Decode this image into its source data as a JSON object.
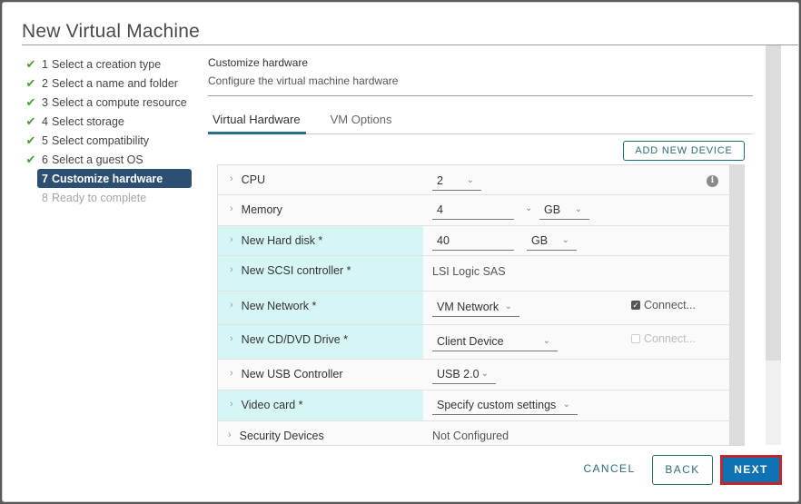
{
  "dialog": {
    "title": "New Virtual Machine"
  },
  "steps": [
    {
      "number": "1",
      "label": "Select a creation type",
      "state": "done"
    },
    {
      "number": "2",
      "label": "Select a name and folder",
      "state": "done"
    },
    {
      "number": "3",
      "label": "Select a compute resource",
      "state": "done"
    },
    {
      "number": "4",
      "label": "Select storage",
      "state": "done"
    },
    {
      "number": "5",
      "label": "Select compatibility",
      "state": "done"
    },
    {
      "number": "6",
      "label": "Select a guest OS",
      "state": "done"
    },
    {
      "number": "7",
      "label": "Customize hardware",
      "state": "active"
    },
    {
      "number": "8",
      "label": "Ready to complete",
      "state": "disabled"
    }
  ],
  "icons": {
    "check": "✔",
    "chevron": "›",
    "dropdown": "⌄",
    "info": "i"
  },
  "content": {
    "title": "Customize hardware",
    "subtitle": "Configure the virtual machine hardware"
  },
  "tabs": [
    {
      "label": "Virtual Hardware",
      "active": true
    },
    {
      "label": "VM Options",
      "active": false
    }
  ],
  "add_device_label": "ADD NEW DEVICE",
  "hardware": {
    "cpu": {
      "label": "CPU",
      "value": "2"
    },
    "memory": {
      "label": "Memory",
      "value": "4",
      "unit": "GB"
    },
    "hard_disk": {
      "label": "New Hard disk *",
      "value": "40",
      "unit": "GB"
    },
    "scsi": {
      "label": "New SCSI controller *",
      "value": "LSI Logic SAS"
    },
    "network": {
      "label": "New Network *",
      "value": "VM Network",
      "connect_label": "Connect...",
      "connect_checked": true
    },
    "cdrom": {
      "label": "New CD/DVD Drive *",
      "value": "Client Device",
      "connect_label": "Connect...",
      "connect_checked": false
    },
    "usb": {
      "label": "New USB Controller",
      "value": "USB 2.0"
    },
    "video": {
      "label": "Video card *",
      "value": "Specify custom settings"
    },
    "security": {
      "label": "Security Devices",
      "value": "Not Configured"
    }
  },
  "footer": {
    "cancel": "CANCEL",
    "back": "BACK",
    "next": "NEXT"
  },
  "colors": {
    "accent": "#0f72b5",
    "highlight": "#d6f6f6",
    "active_step": "#2d4f72",
    "check": "#4c9a3a",
    "next_outline": "#c0272d"
  }
}
